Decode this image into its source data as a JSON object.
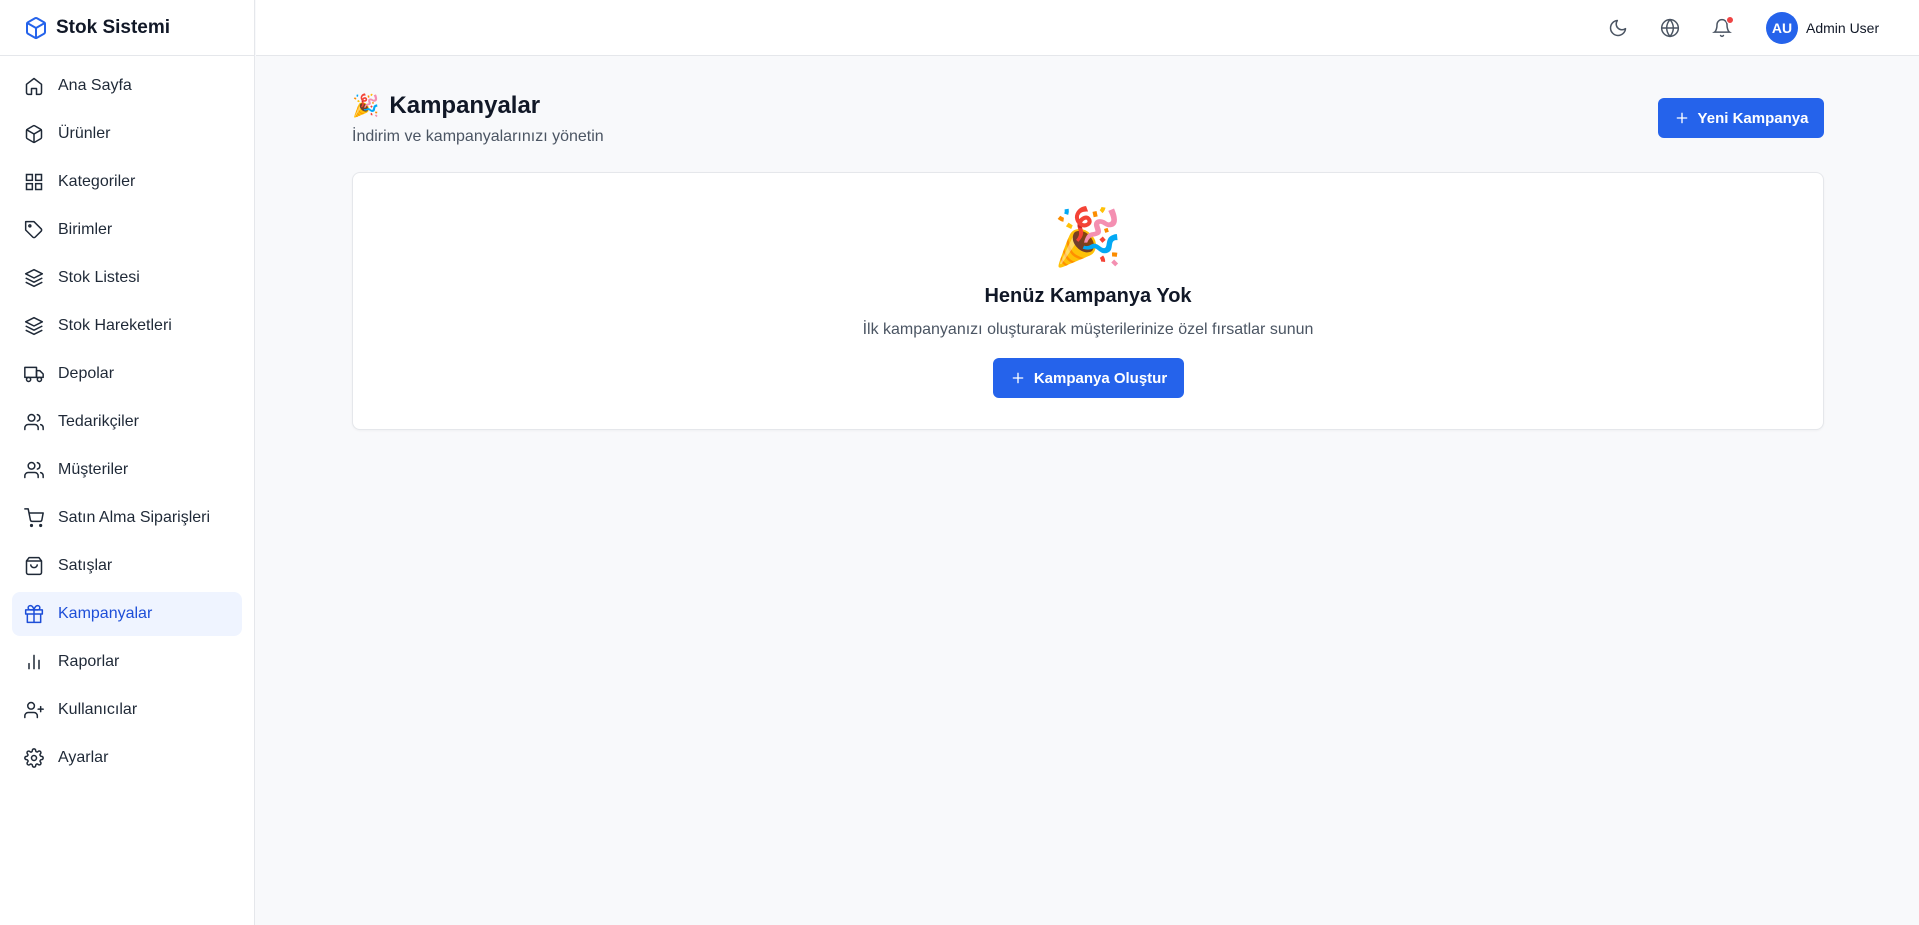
{
  "brand": {
    "title": "Stok Sistemi",
    "icon": "cube-icon",
    "color": "#2563eb"
  },
  "sidebar": {
    "items": [
      {
        "label": "Ana Sayfa",
        "icon": "home-icon"
      },
      {
        "label": "Ürünler",
        "icon": "package-icon"
      },
      {
        "label": "Kategoriler",
        "icon": "grid-icon"
      },
      {
        "label": "Birimler",
        "icon": "tag-icon"
      },
      {
        "label": "Stok Listesi",
        "icon": "layers-icon"
      },
      {
        "label": "Stok Hareketleri",
        "icon": "layers-icon"
      },
      {
        "label": "Depolar",
        "icon": "truck-icon"
      },
      {
        "label": "Tedarikçiler",
        "icon": "users-icon"
      },
      {
        "label": "Müşteriler",
        "icon": "users-icon"
      },
      {
        "label": "Satın Alma Siparişleri",
        "icon": "cart-icon"
      },
      {
        "label": "Satışlar",
        "icon": "shopping-bag-icon"
      },
      {
        "label": "Kampanyalar",
        "icon": "gift-icon",
        "active": true
      },
      {
        "label": "Raporlar",
        "icon": "bar-chart-icon"
      },
      {
        "label": "Kullanıcılar",
        "icon": "user-plus-icon"
      },
      {
        "label": "Ayarlar",
        "icon": "gear-icon"
      }
    ]
  },
  "header": {
    "icons": [
      "moon-icon",
      "globe-icon",
      "bell-icon"
    ],
    "user": {
      "initials": "AU",
      "name": "Admin User"
    }
  },
  "main": {
    "title_emoji": "🎉",
    "title": "Kampanyalar",
    "subtitle": "İndirim ve kampanyalarınızı yönetin",
    "new_button_label": "Yeni Kampanya",
    "empty_state": {
      "emoji": "🎉",
      "title": "Henüz Kampanya Yok",
      "description": "İlk kampanyanızı oluşturarak müşterilerinize özel fırsatlar sunun",
      "button_label": "Kampanya Oluştur"
    }
  },
  "colors": {
    "accent": "#2563eb",
    "active_bg": "#eff4ff",
    "notification_dot": "#ef4444"
  }
}
